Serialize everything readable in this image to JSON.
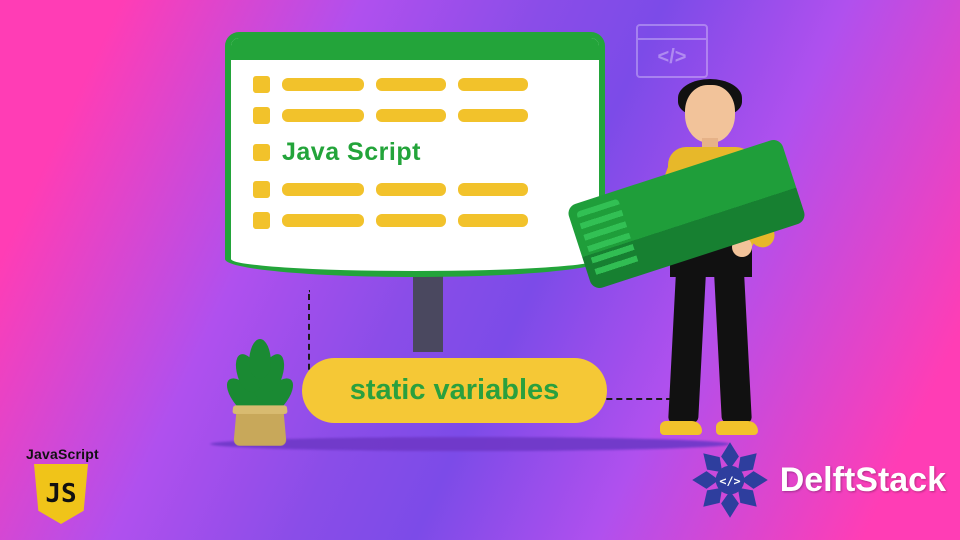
{
  "doc": {
    "label": "Java Script"
  },
  "pill": {
    "text": "static variables"
  },
  "js_logo": {
    "caption": "JavaScript",
    "initials": "JS"
  },
  "brand": {
    "name": "DelftStack",
    "glyph": "</>"
  },
  "codewin": {
    "glyph": "</>"
  }
}
